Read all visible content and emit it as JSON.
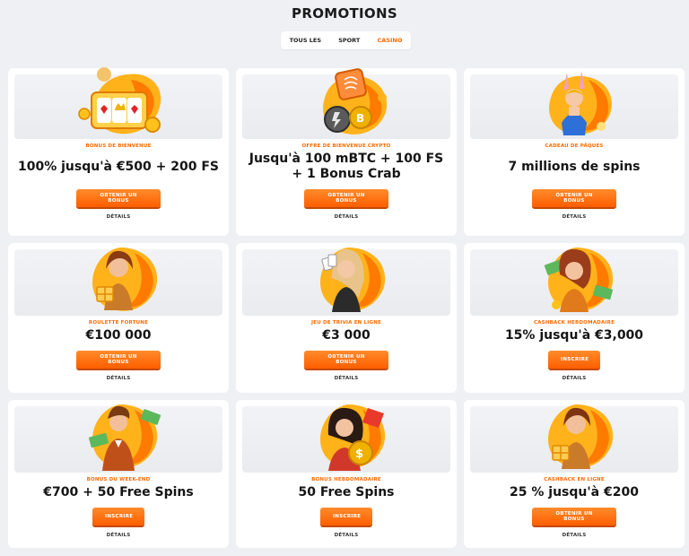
{
  "page": {
    "title": "PROMOTIONS"
  },
  "tabs": [
    {
      "label": "TOUS LES",
      "active": false
    },
    {
      "label": "SPORT",
      "active": false
    },
    {
      "label": "CASINO",
      "active": true
    }
  ],
  "colors": {
    "accent": "#ff6a00",
    "background": "#eef0f4",
    "card": "#ffffff"
  },
  "cards": [
    {
      "category": "BONUS DE BIENVENUE",
      "title": "100% jusqu'à €500 + 200 FS",
      "button": "OBTENIR UN BONUS",
      "link": "DÉTAILS",
      "art": "slot-machine-icon"
    },
    {
      "category": "OFFRE DE BIENVENUE CRYPTO",
      "title": "Jusqu'à 100 mBTC + 100 FS + 1 Bonus Crab",
      "button": "OBTENIR UN BONUS",
      "link": "DÉTAILS",
      "art": "crypto-coins-icon"
    },
    {
      "category": "CADEAU DE PÂQUES",
      "title": "7 millions de spins",
      "button": "OBTENIR UN BONUS",
      "link": "DÉTAILS",
      "art": "bunny-girl-icon"
    },
    {
      "category": "ROULETTE FORTUNE",
      "title": "€100 000",
      "button": "OBTENIR UN BONUS",
      "link": "DÉTAILS",
      "art": "woman-gift-icon"
    },
    {
      "category": "JEU DE TRIVIA EN LIGNE",
      "title": "€3 000",
      "button": "OBTENIR UN BONUS",
      "link": "DÉTAILS",
      "art": "woman-cards-icon"
    },
    {
      "category": "CASHBACK HEBDOMADAIRE",
      "title": "15% jusqu'à €3,000",
      "button": "INSCRIRE",
      "link": "DÉTAILS",
      "art": "woman-cash-icon"
    },
    {
      "category": "BONUS DU WEEK-END",
      "title": "€700 + 50 Free Spins",
      "button": "INSCRIRE",
      "link": "DÉTAILS",
      "art": "man-money-icon"
    },
    {
      "category": "BONUS HEBDOMADAIRE",
      "title": "50 Free Spins",
      "button": "INSCRIRE",
      "link": "DÉTAILS",
      "art": "woman-coin-icon"
    },
    {
      "category": "CASHBACK EN LIGNE",
      "title": "25 % jusqu'à €200",
      "button": "OBTENIR UN BONUS",
      "link": "DÉTAILS",
      "art": "woman-gift-icon"
    }
  ]
}
